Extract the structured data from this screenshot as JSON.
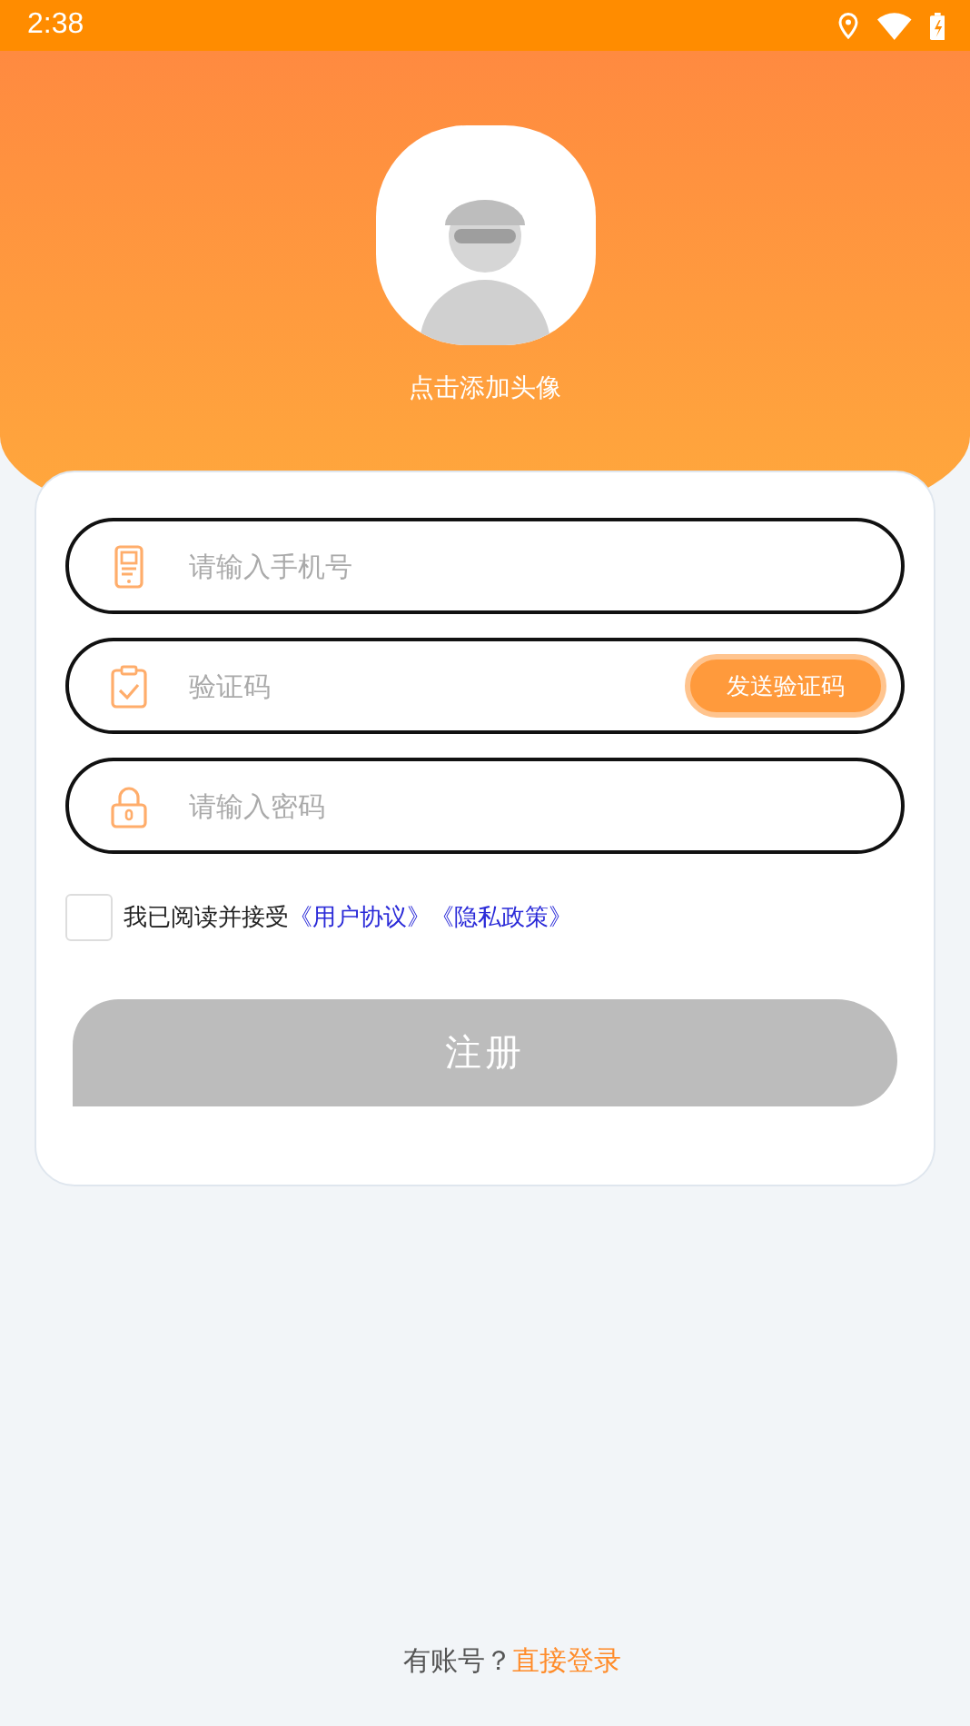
{
  "status_bar": {
    "time": "2:38"
  },
  "avatar": {
    "caption": "点击添加头像"
  },
  "fields": [
    {
      "kind": "phone",
      "placeholder": "请输入手机号"
    },
    {
      "kind": "code",
      "placeholder": "验证码",
      "button": "发送验证码"
    },
    {
      "kind": "password",
      "placeholder": "请输入密码"
    }
  ],
  "agreement": {
    "checked": false,
    "text": "我已阅读并接受",
    "links": [
      "《用户协议》",
      "《隐私政策》"
    ]
  },
  "register_button": {
    "label": "注册",
    "disabled": true
  },
  "footer": {
    "text": "有账号？",
    "link": "直接登录"
  }
}
